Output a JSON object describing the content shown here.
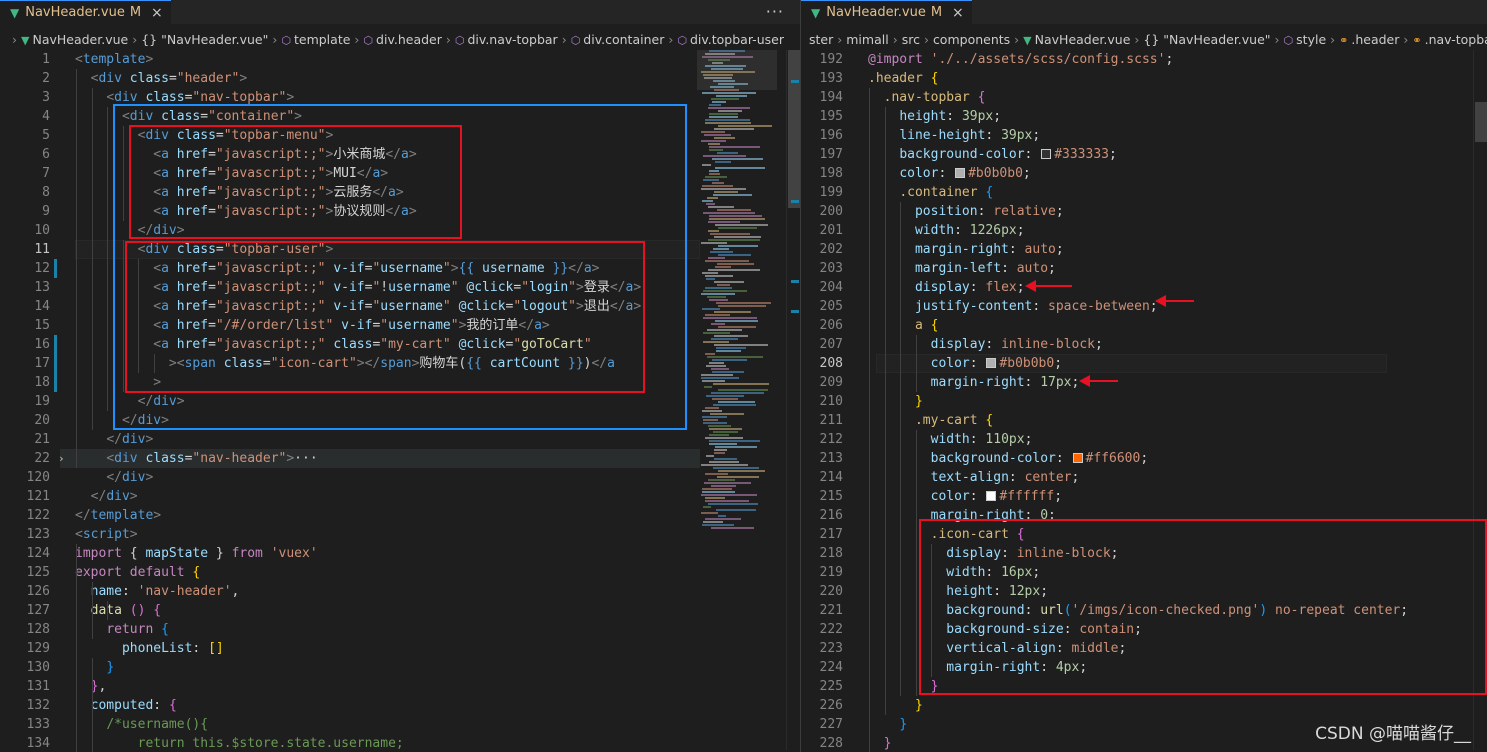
{
  "left": {
    "tab": {
      "title": "NavHeader.vue",
      "modified": "M"
    },
    "more_actions": "···",
    "breadcrumb": [
      {
        "label": "NavHeader.vue",
        "icon": "vue-file-icon"
      },
      {
        "label": "{} \"NavHeader.vue\"",
        "icon": "none"
      },
      {
        "label": "template",
        "icon": "element-icon"
      },
      {
        "label": "div.header",
        "icon": "element-icon"
      },
      {
        "label": "div.nav-topbar",
        "icon": "element-icon"
      },
      {
        "label": "div.container",
        "icon": "element-icon"
      },
      {
        "label": "div.topbar-user",
        "icon": "element-icon"
      }
    ],
    "line_numbers": [
      "1",
      "2",
      "3",
      "4",
      "5",
      "6",
      "7",
      "8",
      "9",
      "10",
      "11",
      "12",
      "13",
      "14",
      "15",
      "16",
      "17",
      "18",
      "19",
      "20",
      "21",
      "22",
      "120",
      "121",
      "122",
      "123",
      "124",
      "125",
      "126",
      "127",
      "128",
      "129",
      "130",
      "131",
      "132",
      "133",
      "134"
    ],
    "current_line": "11"
  },
  "right": {
    "tab": {
      "title": "NavHeader.vue",
      "modified": "M"
    },
    "breadcrumb": [
      {
        "label": "ster",
        "icon": "none"
      },
      {
        "label": "mimall",
        "icon": "none"
      },
      {
        "label": "src",
        "icon": "none"
      },
      {
        "label": "components",
        "icon": "none"
      },
      {
        "label": "NavHeader.vue",
        "icon": "vue-file-icon"
      },
      {
        "label": "{} \"NavHeader.vue\"",
        "icon": "none"
      },
      {
        "label": "style",
        "icon": "element-icon"
      },
      {
        "label": ".header",
        "icon": "selector-icon"
      },
      {
        "label": ".nav-topbar",
        "icon": "selector-icon"
      }
    ],
    "line_numbers": [
      "192",
      "193",
      "194",
      "195",
      "196",
      "197",
      "198",
      "199",
      "200",
      "201",
      "202",
      "203",
      "204",
      "205",
      "206",
      "207",
      "208",
      "209",
      "210",
      "211",
      "212",
      "213",
      "214",
      "215",
      "216",
      "217",
      "218",
      "219",
      "220",
      "221",
      "222",
      "223",
      "224",
      "225",
      "226",
      "227",
      "228"
    ],
    "current_line": "208",
    "swatches": {
      "c333333": "#333333",
      "cb0b0b0": "#b0b0b0",
      "cff6600": "#ff6600",
      "cffffff": "#ffffff"
    }
  },
  "colors": {
    "annotation_red": "#e81123",
    "annotation_blue": "#1e90ff",
    "accent": "#3794ff"
  },
  "watermark": "CSDN @喵喵酱仔__"
}
